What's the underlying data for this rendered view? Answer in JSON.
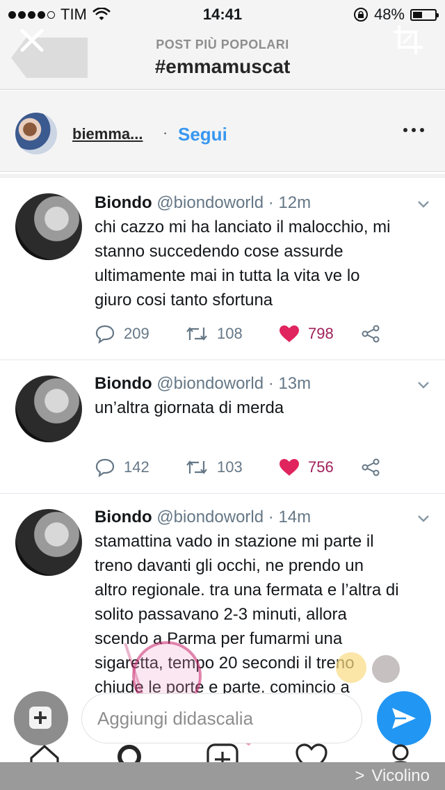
{
  "status_bar": {
    "carrier": "TIM",
    "time": "14:41",
    "battery_percent": "48%",
    "battery_level": 0.48,
    "icons": [
      "signal-dots",
      "wifi-icon",
      "rotation-lock-icon",
      "battery-icon"
    ]
  },
  "header": {
    "subtitle": "POST PIÙ POPOLARI",
    "title": "#emmamuscat",
    "icons": [
      "close-icon",
      "crop-icon"
    ]
  },
  "post": {
    "username": "biemma...",
    "separator": "·",
    "follow_label": "Segui",
    "more_icon": "more-icon"
  },
  "tweets": [
    {
      "name": "Biondo",
      "handle": "@biondoworld",
      "time": "· 12m",
      "lines": [
        "chi cazzo mi ha lanciato il malocchio, mi",
        "stanno succedendo cose assurde",
        "ultimamente mai in tutta la vita ve lo",
        "giuro cosi tanto sfortuna"
      ],
      "replies": "209",
      "retweets": "108",
      "likes": "798"
    },
    {
      "name": "Biondo",
      "handle": "@biondoworld",
      "time": "· 13m",
      "lines": [
        "un’altra giornata di merda"
      ],
      "replies": "142",
      "retweets": "103",
      "likes": "756"
    },
    {
      "name": "Biondo",
      "handle": "@biondoworld",
      "time": "· 14m",
      "lines": [
        "stamattina vado in stazione mi parte il",
        "treno davanti gli occhi, ne prendo un",
        "altro regionale. tra una fermata e l’altra di",
        "solito passavano 2-3 minuti, allora",
        "scendo a Parma per fumarmi una",
        "sigaretta, tempo 20 secondi il treno",
        "chiude le porte e parte. comincio a"
      ]
    }
  ],
  "caption": {
    "placeholder": "Aggiungi didascalia"
  },
  "tabs": [
    "home-icon",
    "search-icon",
    "add-post-icon",
    "heart-icon",
    "profile-icon"
  ],
  "footer": {
    "label": "Vicolino",
    "chevron": ">"
  },
  "colors": {
    "accent_blue": "#3897f0",
    "like_pink": "#e0245e",
    "send_blue": "#2196f3"
  }
}
